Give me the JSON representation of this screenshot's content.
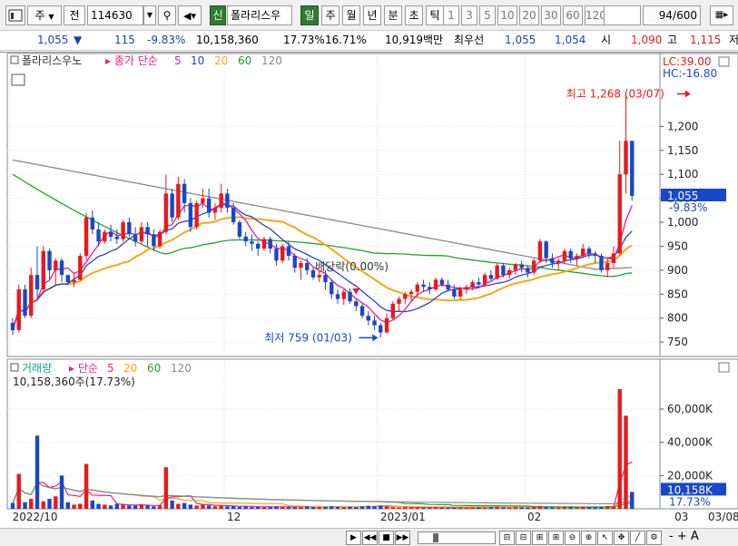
{
  "toolbar": {
    "market": "주",
    "type": "전",
    "code": "114630",
    "new_label": "신",
    "stock_name": "폴라리스우",
    "periods": [
      "일",
      "주",
      "월",
      "년",
      "분",
      "초",
      "틱"
    ],
    "selected_period": "일",
    "intervals": [
      "1",
      "3",
      "5",
      "10",
      "20",
      "30",
      "60",
      "120"
    ],
    "count": "94",
    "count_total": "/600"
  },
  "info": {
    "price": "1,055",
    "change_arrow": "▼",
    "change": "115",
    "change_pct": "-9.83%",
    "volume": "10,158,360",
    "vol_pct": "17.73%",
    "turnover_pct": "16.71%",
    "amount": "10,919백만",
    "best_ask_label": "최우선",
    "best_ask": "1,055",
    "best_bid": "1,054",
    "open_label": "시",
    "open": "1,090",
    "high_label": "고",
    "high": "1,115",
    "low_label": "저"
  },
  "legend": {
    "stock": "폴라리스우노",
    "ma_label": "종가 단순",
    "ma_periods": [
      "5",
      "10",
      "20",
      "60",
      "120"
    ],
    "vol_label": "거래량",
    "vol_ma_label": "단순",
    "vol_ma_periods": [
      "5",
      "20",
      "60",
      "120"
    ],
    "vol_current": "10,158,360주(17.73%)"
  },
  "colors": {
    "up": "#e8191c",
    "down": "#1a47c9",
    "ma5": "#e81e8c",
    "ma10": "#2c3fd6",
    "ma20": "#f4a818",
    "ma60": "#22a22c",
    "ma120": "#8a8a8a"
  },
  "chart_data": {
    "type": "candlestick",
    "price_axis": {
      "ylim": [
        720,
        1320
      ],
      "ticks": [
        750,
        800,
        850,
        900,
        950,
        1000,
        1050,
        1100,
        1150,
        1200
      ]
    },
    "volume_axis": {
      "ylim": [
        0,
        78000
      ],
      "ticks": [
        20000,
        40000,
        60000
      ],
      "tick_labels": [
        "20,000K",
        "40,000K",
        "60,000K"
      ]
    },
    "x_labels": [
      {
        "label": "2022/10",
        "index": 0
      },
      {
        "label": "12",
        "index": 35
      },
      {
        "label": "2023/01",
        "index": 60
      },
      {
        "label": "02",
        "index": 84
      },
      {
        "label": "03",
        "index": 108
      },
      {
        "label": "03/08",
        "index": 121
      }
    ],
    "right_labels": {
      "lc": "LC:39.00",
      "hc": "HC:-16.80",
      "price": "1,055",
      "price_pct": "-9.83%",
      "vol": "10,158K",
      "vol_pct": "17.73%"
    },
    "annotations": {
      "high": "최고 1,268 (03/07)",
      "low": "최저 759 (01/03)",
      "dividend": "배당락(0.00%)"
    },
    "high_low": {
      "high_value": 1268,
      "high_index": 111,
      "low_value": 759,
      "low_index": 60
    },
    "dividend_index": 56,
    "ohlc": [
      [
        790,
        800,
        765,
        775
      ],
      [
        775,
        870,
        770,
        860
      ],
      [
        860,
        870,
        800,
        805
      ],
      [
        805,
        905,
        800,
        890
      ],
      [
        890,
        950,
        840,
        860
      ],
      [
        860,
        950,
        850,
        940
      ],
      [
        940,
        945,
        880,
        900
      ],
      [
        900,
        925,
        870,
        920
      ],
      [
        920,
        925,
        875,
        890
      ],
      [
        890,
        890,
        870,
        875
      ],
      [
        875,
        895,
        865,
        880
      ],
      [
        880,
        935,
        878,
        930
      ],
      [
        930,
        1020,
        920,
        1010
      ],
      [
        1010,
        1025,
        975,
        985
      ],
      [
        985,
        1000,
        950,
        960
      ],
      [
        960,
        985,
        955,
        980
      ],
      [
        980,
        995,
        960,
        970
      ],
      [
        970,
        985,
        955,
        965
      ],
      [
        965,
        1005,
        960,
        1000
      ],
      [
        1000,
        1010,
        970,
        975
      ],
      [
        975,
        990,
        950,
        960
      ],
      [
        960,
        1000,
        955,
        990
      ],
      [
        990,
        1000,
        950,
        975
      ],
      [
        975,
        985,
        940,
        950
      ],
      [
        950,
        985,
        945,
        980
      ],
      [
        980,
        1100,
        975,
        1060
      ],
      [
        1060,
        1070,
        1000,
        1010
      ],
      [
        1010,
        1095,
        1005,
        1080
      ],
      [
        1080,
        1090,
        1020,
        1040
      ],
      [
        1040,
        1050,
        980,
        990
      ],
      [
        990,
        1045,
        985,
        1040
      ],
      [
        1040,
        1070,
        1030,
        1050
      ],
      [
        1050,
        1070,
        1010,
        1020
      ],
      [
        1020,
        1040,
        1005,
        1030
      ],
      [
        1030,
        1080,
        1020,
        1060
      ],
      [
        1060,
        1070,
        1020,
        1030
      ],
      [
        1030,
        1040,
        995,
        1000
      ],
      [
        1000,
        1005,
        965,
        970
      ],
      [
        970,
        980,
        950,
        960
      ],
      [
        960,
        975,
        940,
        955
      ],
      [
        955,
        960,
        930,
        945
      ],
      [
        945,
        970,
        940,
        965
      ],
      [
        965,
        970,
        935,
        945
      ],
      [
        945,
        955,
        910,
        920
      ],
      [
        920,
        955,
        915,
        950
      ],
      [
        950,
        960,
        920,
        930
      ],
      [
        930,
        935,
        895,
        905
      ],
      [
        905,
        920,
        880,
        915
      ],
      [
        915,
        925,
        890,
        900
      ],
      [
        900,
        905,
        880,
        885
      ],
      [
        885,
        900,
        875,
        890
      ],
      [
        890,
        900,
        860,
        875
      ],
      [
        875,
        880,
        840,
        850
      ],
      [
        850,
        860,
        830,
        840
      ],
      [
        840,
        860,
        828,
        855
      ],
      [
        855,
        862,
        830,
        835
      ],
      [
        835,
        840,
        815,
        825
      ],
      [
        825,
        830,
        800,
        805
      ],
      [
        805,
        815,
        785,
        795
      ],
      [
        795,
        805,
        775,
        785
      ],
      [
        785,
        790,
        759,
        770
      ],
      [
        770,
        810,
        768,
        800
      ],
      [
        800,
        835,
        795,
        830
      ],
      [
        830,
        845,
        815,
        840
      ],
      [
        840,
        855,
        830,
        850
      ],
      [
        850,
        860,
        835,
        855
      ],
      [
        855,
        875,
        845,
        870
      ],
      [
        870,
        880,
        855,
        865
      ],
      [
        865,
        875,
        850,
        860
      ],
      [
        860,
        885,
        855,
        880
      ],
      [
        880,
        885,
        865,
        870
      ],
      [
        870,
        880,
        855,
        860
      ],
      [
        860,
        870,
        840,
        845
      ],
      [
        845,
        865,
        838,
        860
      ],
      [
        860,
        870,
        850,
        865
      ],
      [
        865,
        880,
        858,
        875
      ],
      [
        875,
        885,
        862,
        870
      ],
      [
        870,
        895,
        865,
        890
      ],
      [
        890,
        900,
        878,
        882
      ],
      [
        882,
        915,
        880,
        910
      ],
      [
        910,
        915,
        885,
        890
      ],
      [
        890,
        905,
        882,
        900
      ],
      [
        900,
        915,
        890,
        912
      ],
      [
        912,
        920,
        895,
        905
      ],
      [
        905,
        910,
        885,
        895
      ],
      [
        895,
        925,
        890,
        920
      ],
      [
        920,
        965,
        915,
        960
      ],
      [
        960,
        962,
        915,
        925
      ],
      [
        925,
        935,
        905,
        915
      ],
      [
        915,
        925,
        900,
        920
      ],
      [
        920,
        945,
        912,
        940
      ],
      [
        940,
        945,
        915,
        925
      ],
      [
        925,
        935,
        910,
        930
      ],
      [
        930,
        955,
        925,
        945
      ],
      [
        945,
        950,
        925,
        935
      ],
      [
        935,
        940,
        915,
        930
      ],
      [
        930,
        935,
        895,
        900
      ],
      [
        900,
        925,
        885,
        915
      ],
      [
        915,
        950,
        905,
        935
      ],
      [
        935,
        1170,
        930,
        1100
      ],
      [
        1100,
        1268,
        1060,
        1170
      ],
      [
        1170,
        1115,
        1045,
        1055
      ]
    ],
    "volume": [
      3500,
      21000,
      4000,
      6000,
      44000,
      4500,
      6000,
      7500,
      20000,
      4000,
      2500,
      3000,
      27000,
      5000,
      3000,
      2500,
      2000,
      3000,
      2500,
      2000,
      2000,
      2500,
      2000,
      1500,
      2000,
      25000,
      5000,
      3000,
      3500,
      2500,
      2000,
      2500,
      2000,
      1500,
      2000,
      1500,
      1500,
      1200,
      1500,
      1000,
      1200,
      1000,
      1200,
      1500,
      1200,
      1000,
      1000,
      1200,
      1500,
      1000,
      1000,
      1200,
      1500,
      1200,
      1000,
      1200,
      1000,
      1500,
      1800,
      1500,
      2000,
      1500,
      1000,
      800,
      1000,
      900,
      1000,
      800,
      900,
      1000,
      800,
      700,
      800,
      900,
      700,
      800,
      900,
      800,
      1000,
      1200,
      900,
      800,
      1000,
      900,
      800,
      1000,
      1500,
      1000,
      900,
      800,
      1000,
      900,
      800,
      1200,
      1000,
      900,
      1000,
      1500,
      1200,
      72000,
      56000,
      10158
    ]
  }
}
